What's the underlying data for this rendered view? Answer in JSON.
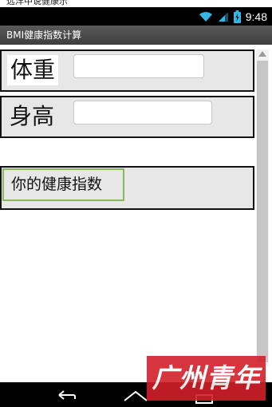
{
  "top_caption": "远洋中说健康示",
  "status_bar": {
    "time": "9:48",
    "icons": [
      "wifi-icon",
      "signal-icon",
      "battery-icon"
    ]
  },
  "app": {
    "title": "BMI健康指数计算"
  },
  "form": {
    "weight_label": "体重",
    "weight_value": "",
    "height_label": "身高",
    "height_value": "",
    "result_button_label": "你的健康指数"
  },
  "nav_bar": {
    "icons": [
      "back-icon",
      "home-icon",
      "recent-apps-icon"
    ]
  },
  "watermark": {
    "text": "广州青年报"
  },
  "colors": {
    "title_bar": "#4a4a4a",
    "row_background": "#e7e7e7",
    "button_border": "#8ab75a",
    "watermark": "#d2202a",
    "status_icons": "#33b5e5"
  }
}
